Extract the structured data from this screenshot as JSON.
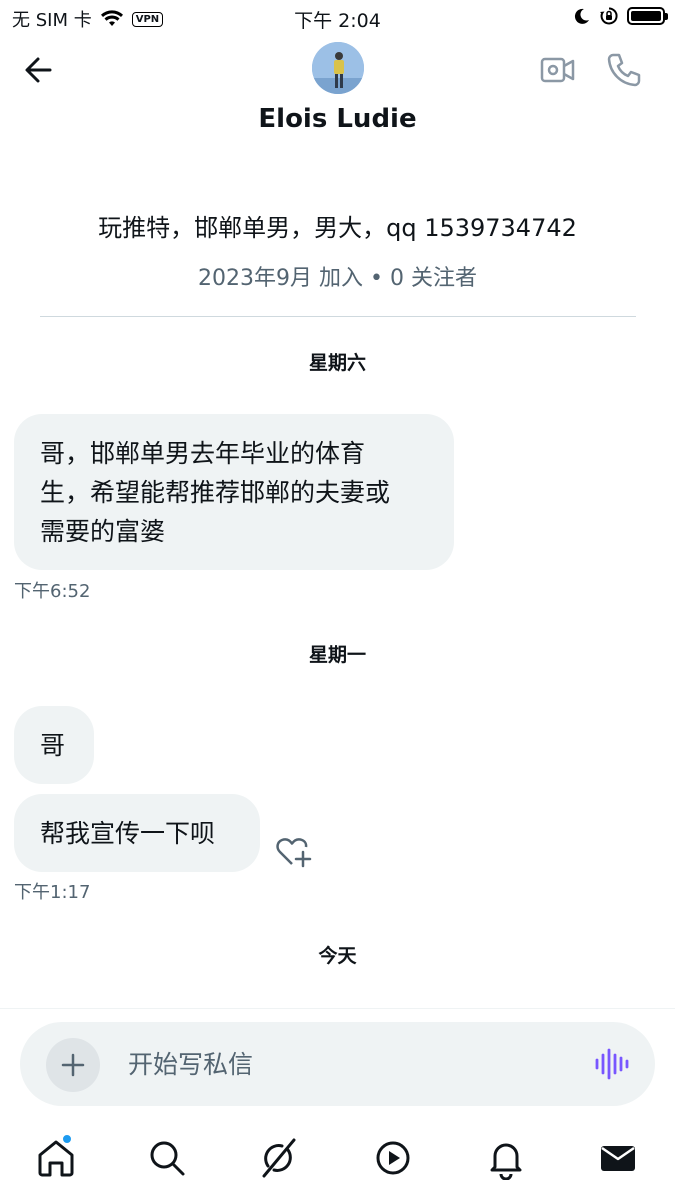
{
  "status_bar": {
    "carrier": "无 SIM 卡",
    "vpn": "VPN",
    "time": "下午 2:04"
  },
  "header": {
    "contact_name": "Elois Ludie"
  },
  "profile": {
    "bio": "玩推特，邯郸单男，男大，qq 1539734742",
    "meta": "2023年9月 加入 • 0 关注者"
  },
  "conversation": {
    "groups": [
      {
        "day": "星期六",
        "messages": [
          {
            "lines": [
              "哥，邯郸单男去年毕业的体育",
              "生，希望能帮推荐邯郸的夫妻或",
              "需要的富婆"
            ]
          }
        ],
        "time": "下午6:52"
      },
      {
        "day": "星期一",
        "messages": [
          {
            "lines": [
              "哥"
            ]
          },
          {
            "lines": [
              "帮我宣传一下呗"
            ]
          }
        ],
        "time": "下午1:17"
      },
      {
        "day": "今天"
      }
    ]
  },
  "composer": {
    "placeholder": "开始写私信"
  },
  "colors": {
    "accent": "#1d9bf0",
    "bubble": "#eff3f4",
    "secondary_text": "#536471",
    "voice_icon": "#7856ff"
  },
  "icons": [
    "back-arrow-icon",
    "video-call-icon",
    "phone-call-icon",
    "add-reaction-icon",
    "plus-icon",
    "voice-message-icon",
    "home-icon",
    "search-icon",
    "grok-icon",
    "video-play-icon",
    "bell-icon",
    "mail-icon"
  ]
}
